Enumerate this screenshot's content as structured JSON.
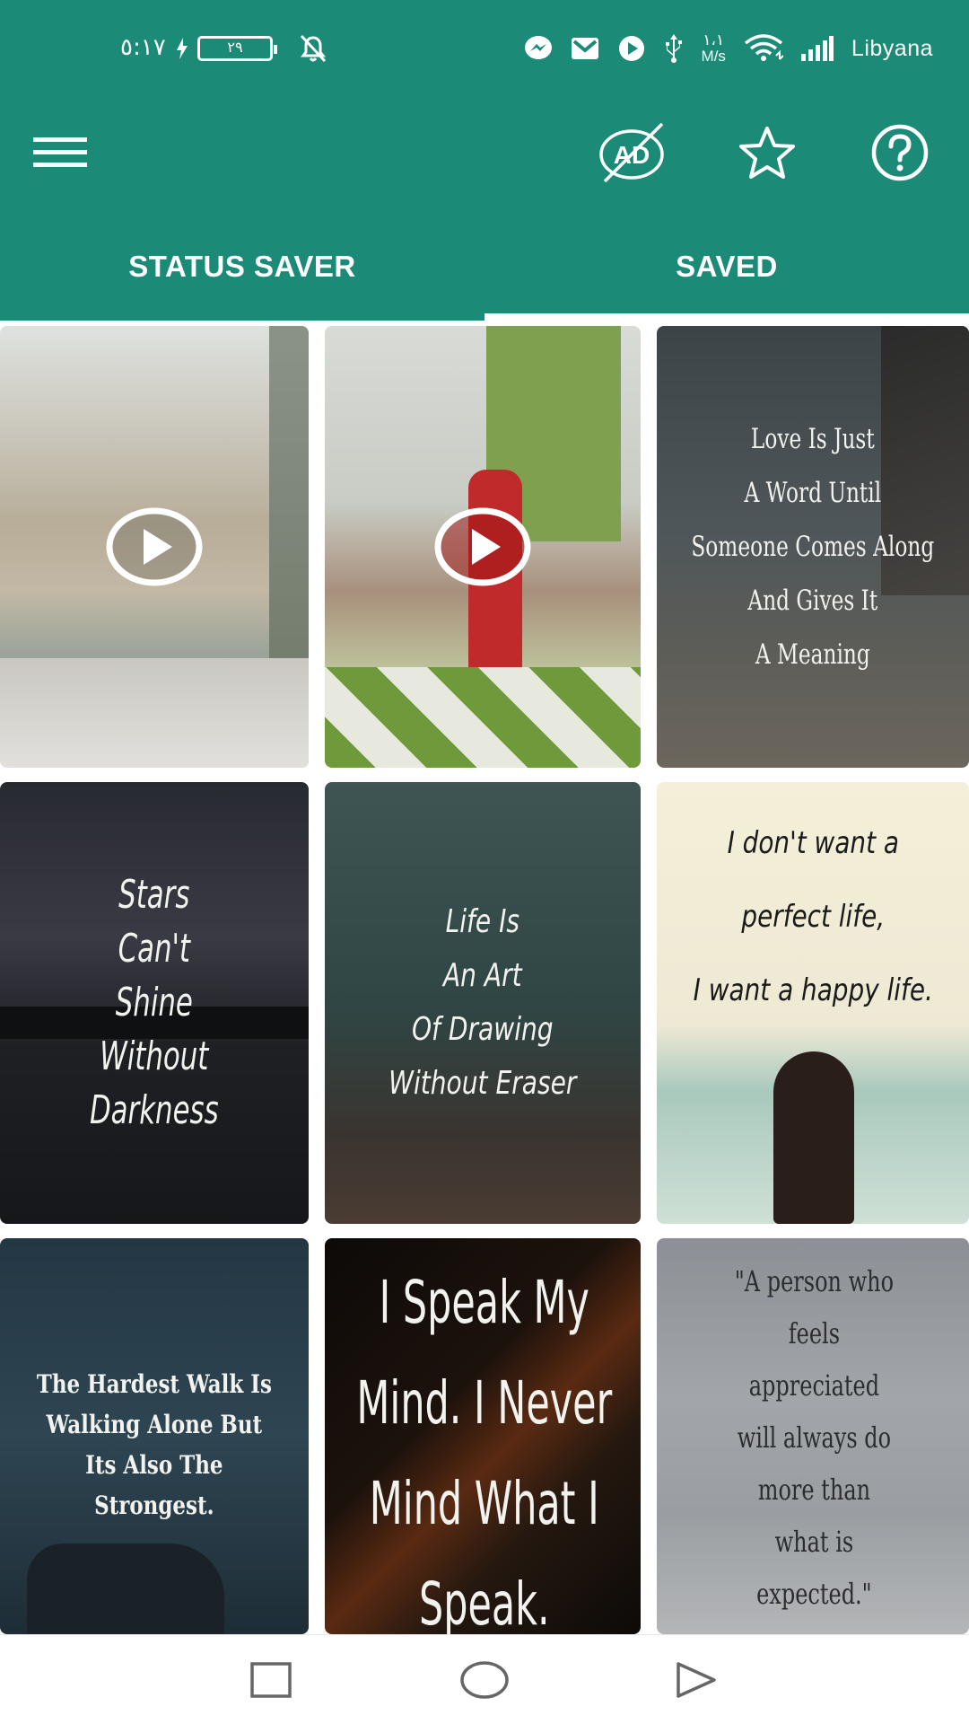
{
  "status_bar": {
    "time": "٥:١٧",
    "battery": "٢٩",
    "net_speed_value": "١،١",
    "net_speed_unit": "M/s",
    "carrier": "Libyana"
  },
  "toolbar": {
    "menu_icon": "hamburger-menu-icon",
    "remove_ads_icon": "no-ads-icon",
    "favorite_icon": "star-icon",
    "help_icon": "question-circle-icon",
    "ad_text": "AD"
  },
  "tabs": [
    {
      "label": "STATUS SAVER",
      "selected": false
    },
    {
      "label": "SAVED",
      "selected": true
    }
  ],
  "colors": {
    "primary": "#1b8a76",
    "tab_indicator": "#ffffff"
  },
  "grid_items": [
    {
      "type": "video",
      "quote": ""
    },
    {
      "type": "video",
      "quote": ""
    },
    {
      "type": "image",
      "quote": "Love Is Just\nA Word Until\nSomeone Comes Along\nAnd Gives It\nA Meaning"
    },
    {
      "type": "image",
      "quote": "Stars\nCan't\nShine\nWithout\nDarkness"
    },
    {
      "type": "image",
      "quote": "Life Is\nAn Art\nOf Drawing\nWithout Eraser"
    },
    {
      "type": "image",
      "quote": "I don't want a\nperfect life,\nI want a happy life."
    },
    {
      "type": "image",
      "quote": "The Hardest Walk Is\nWalking Alone But\nIts Also The\nStrongest."
    },
    {
      "type": "image",
      "quote": "I Speak My\nMind. I Never\nMind What I\nSpeak."
    },
    {
      "type": "image",
      "quote": "\"A person who\nfeels\nappreciated\nwill always do\nmore than\nwhat is\nexpected.\""
    }
  ],
  "nav_bar": {
    "recents_icon": "square-recents-icon",
    "home_icon": "circle-home-icon",
    "back_icon": "triangle-back-icon"
  }
}
